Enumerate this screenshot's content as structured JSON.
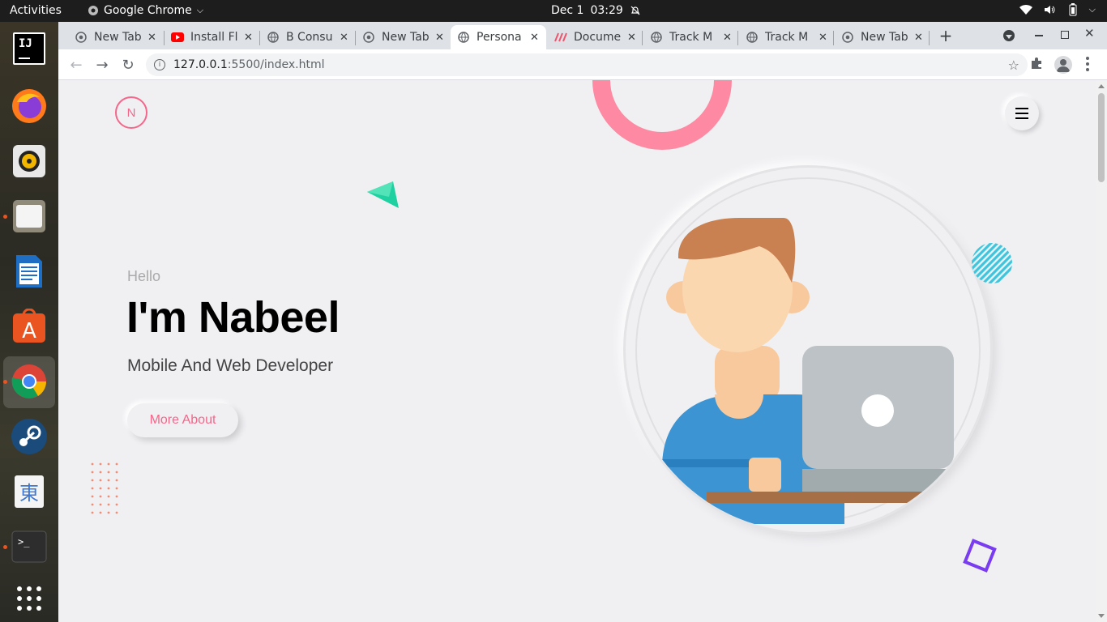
{
  "topbar": {
    "activities": "Activities",
    "app_name": "Google Chrome",
    "date": "Dec 1",
    "time": "03:29"
  },
  "dock": {
    "items": [
      "intellij-idea",
      "firefox",
      "rhythmbox",
      "files",
      "libreoffice-writer",
      "ubuntu-software",
      "google-chrome",
      "steam",
      "language-input",
      "terminal",
      "show-applications"
    ]
  },
  "tabs": [
    {
      "title": "New Tab",
      "icon": "chrome-icon"
    },
    {
      "title": "Install Fl",
      "icon": "youtube-icon"
    },
    {
      "title": "B Consu",
      "icon": "globe-icon"
    },
    {
      "title": "New Tab",
      "icon": "chrome-icon"
    },
    {
      "title": "Persona",
      "icon": "globe-icon",
      "active": true
    },
    {
      "title": "Docume",
      "icon": "docs-icon"
    },
    {
      "title": "Track M",
      "icon": "globe-icon"
    },
    {
      "title": "Track M",
      "icon": "globe-icon"
    },
    {
      "title": "New Tab",
      "icon": "chrome-icon"
    }
  ],
  "toolbar": {
    "url_host": "127.0.0.1",
    "url_rest": ":5500/index.html"
  },
  "page": {
    "logo": "N",
    "hello": "Hello",
    "name": "I'm Nabeel",
    "role": "Mobile And Web Developer",
    "cta": "More About"
  },
  "colors": {
    "accent": "#f5678a",
    "background": "#f0f0f3",
    "triangle": "#1fd1a0",
    "striped_circle": "#3ec5de",
    "square": "#7a3cf0"
  }
}
